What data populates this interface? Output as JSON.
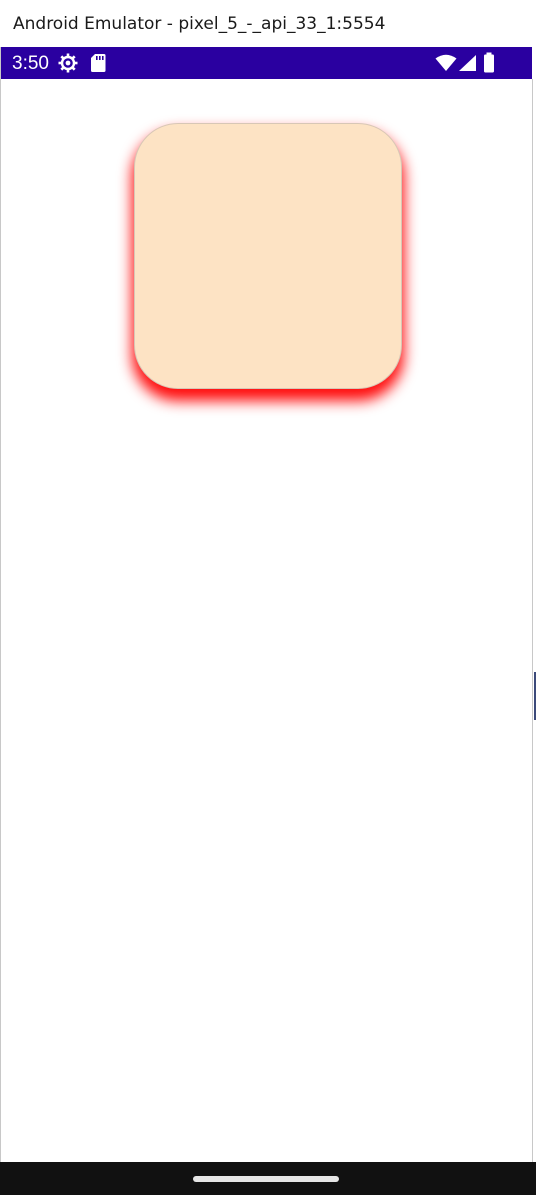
{
  "window": {
    "title": "Android Emulator - pixel_5_-_api_33_1:5554"
  },
  "status_bar": {
    "time": "3:50",
    "left_icons": [
      "settings-gear-icon",
      "sd-card-icon"
    ],
    "right_icons": [
      "wifi-icon",
      "cellular-signal-icon",
      "battery-icon"
    ],
    "background_color": "#2a00a0"
  },
  "content": {
    "box": {
      "fill_color": "#fde3c4",
      "shadow_color": "#ff0000"
    }
  },
  "nav_bar": {
    "background_color": "#111111"
  }
}
